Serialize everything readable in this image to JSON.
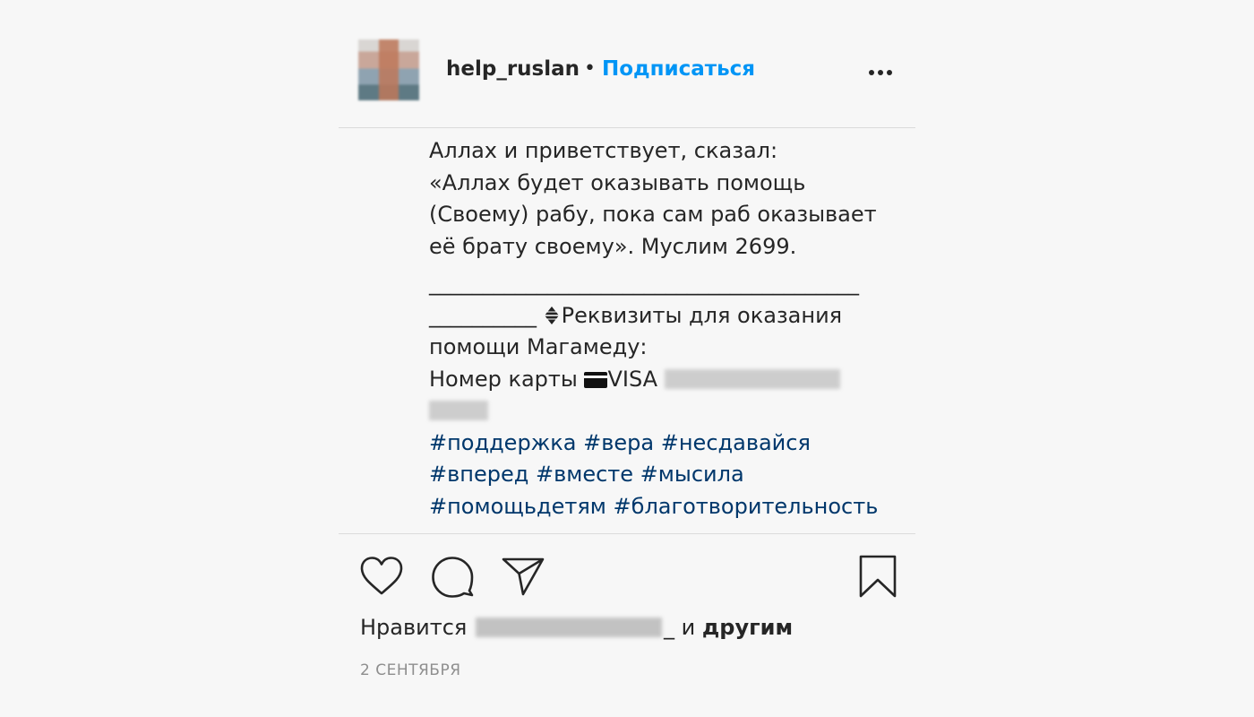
{
  "header": {
    "username": "help_ruslan",
    "separator": "•",
    "follow_label": "Подписаться"
  },
  "caption": {
    "lines": [
      "Аллах и приветствует, сказал:",
      "«Аллах будет оказывать помощь",
      "(Своему) рабу, пока сам раб оказывает",
      "её брату своему». Муслим 2699."
    ],
    "separator_line_1": "________________________________________",
    "separator_line_2": "__________",
    "requisites_line_1": "Реквизиты для оказания",
    "requisites_line_2": "помощи Магамеду:",
    "card_label": "Номер карты",
    "card_brand": "VISA",
    "hashtags": [
      [
        "#поддержка",
        "#вера",
        "#несдавайся"
      ],
      [
        "#вперед",
        "#вместе",
        "#мысила"
      ],
      [
        "#помощьдетям",
        "#благотворительность"
      ]
    ]
  },
  "actions": {
    "icons": [
      "heart-icon",
      "comment-icon",
      "share-icon",
      "bookmark-icon"
    ]
  },
  "likes": {
    "prefix": "Нравится",
    "suffix": "_",
    "conj": "и",
    "others": "другим"
  },
  "date": "2 СЕНТЯБРЯ",
  "colors": {
    "follow": "#0095f6",
    "hashtag": "#00376b",
    "text": "#262626",
    "muted": "#8e8e8e",
    "background": "#f7f7f7"
  }
}
